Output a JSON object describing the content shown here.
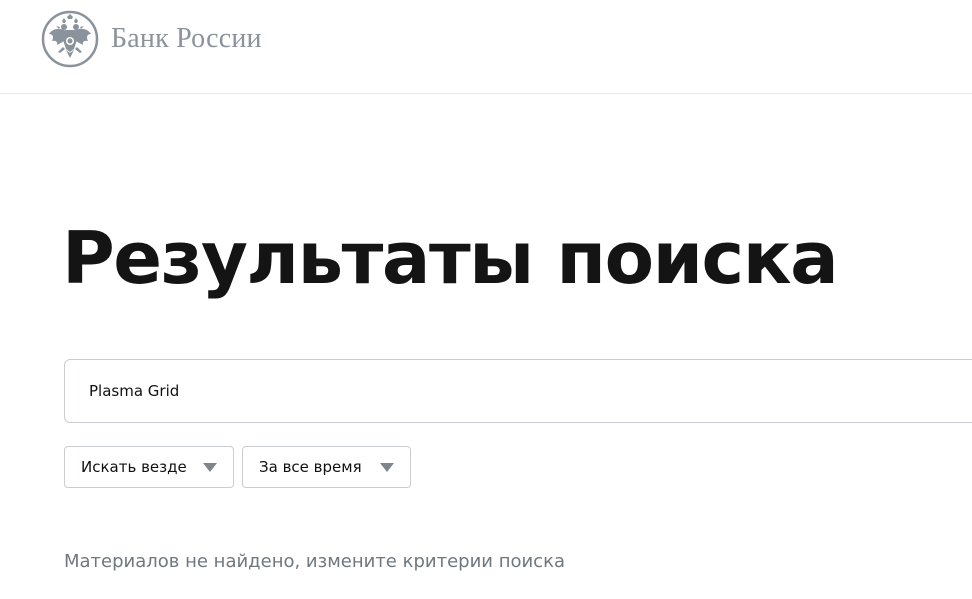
{
  "header": {
    "logo_text": "Банк России",
    "logo_icon": "double-headed-eagle-emblem"
  },
  "main": {
    "title": "Результаты поиска",
    "search": {
      "value": "Plasma Grid",
      "placeholder": ""
    },
    "filters": [
      {
        "label": "Искать везде",
        "icon": "chevron-down-icon"
      },
      {
        "label": "За все время",
        "icon": "chevron-down-icon"
      }
    ],
    "empty_message": "Материалов не найдено, измените критерии поиска"
  },
  "colors": {
    "logo_gray": "#8a939c",
    "title": "#141414",
    "border": "#c9cdd2",
    "muted_text": "#6f777f"
  }
}
